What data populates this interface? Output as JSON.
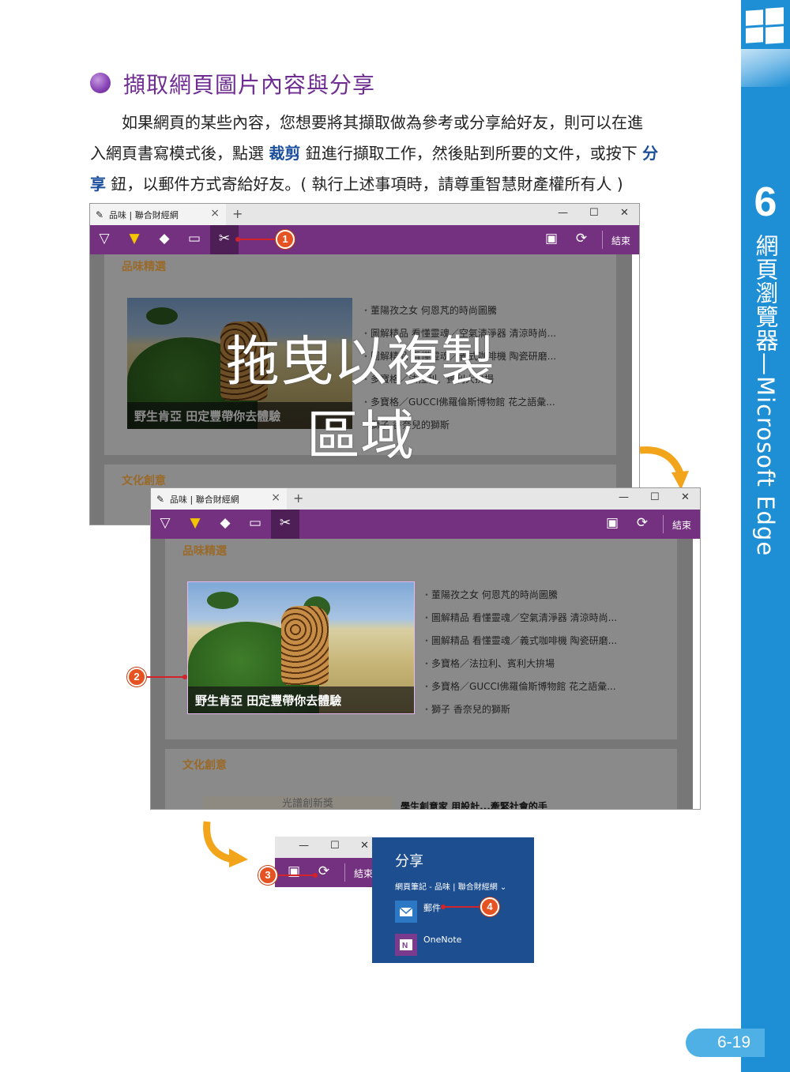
{
  "heading": "擷取網頁圖片內容與分享",
  "paragraph": {
    "l1": "如果網頁的某些內容，您想要將其擷取做為參考或分享給好友，則可以在進",
    "l2a": "入網頁書寫模式後，點選 ",
    "kw1": "裁剪",
    "l2b": " 鈕進行擷取工作，然後貼到所要的文件，或按下 ",
    "kw2a": "分",
    "kw2b": "享",
    "l3": " 鈕，以郵件方式寄給好友。( 執行上述事項時，請尊重智慧財產權所有人 )"
  },
  "browser": {
    "tab_title": "品味 | 聯合財經網",
    "finish": "結束",
    "section1": "品味精選",
    "section2": "文化創意",
    "photo_caption": "野生肯亞 田定豐帶你去體驗",
    "list": [
      "董陽孜之女 何恩芃的時尚圖騰",
      "圖解精品 看懂靈魂／空氣清淨器 清涼時尚...",
      "圖解精品 看懂靈魂／義式咖啡機 陶瓷研磨...",
      "多寶格／法拉利、賓利大拚場",
      "多寶格／GUCCI佛羅倫斯博物館 花之語彙...",
      "獅子 香奈兒的獅斯"
    ],
    "overlay_text": "拖曳以複製區域",
    "bottom_text1": "光譜創新獎",
    "bottom_text2": "學生創意家 用設計...牽緊社會的手"
  },
  "share": {
    "title": "分享",
    "subtitle": "網頁筆記 - 品味 | 聯合財經網",
    "mail": "郵件",
    "onenote": "OneNote"
  },
  "callouts": [
    "1",
    "2",
    "3",
    "4"
  ],
  "side": {
    "chapter_number": "6",
    "chapter_title": "網頁瀏覽器—Microsoft Edge"
  },
  "page_number": "6-19",
  "colors": {
    "accent_purple": "#6f2d91",
    "toolbar_purple": "#74317f",
    "side_blue": "#1e8fd5",
    "keyword_blue": "#1b4f9c"
  }
}
